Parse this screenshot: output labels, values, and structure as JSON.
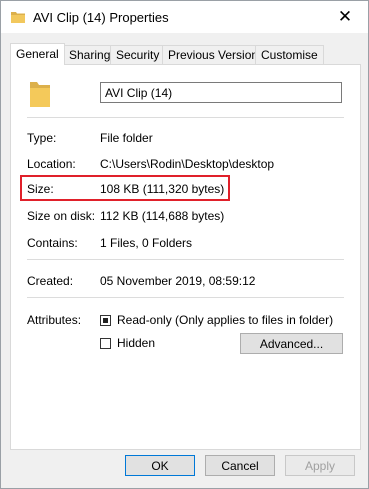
{
  "window": {
    "title": "AVI Clip (14) Properties",
    "close_symbol": "✕"
  },
  "tabs": [
    {
      "label": "General"
    },
    {
      "label": "Sharing"
    },
    {
      "label": "Security"
    },
    {
      "label": "Previous Versions"
    },
    {
      "label": "Customise"
    }
  ],
  "general": {
    "name": "AVI Clip (14)",
    "type_label": "Type:",
    "type_value": "File folder",
    "location_label": "Location:",
    "location_value": "C:\\Users\\Rodin\\Desktop\\desktop",
    "size_label": "Size:",
    "size_value": "108 KB (111,320 bytes)",
    "size_on_disk_label": "Size on disk:",
    "size_on_disk_value": "112 KB (114,688 bytes)",
    "contains_label": "Contains:",
    "contains_value": "1 Files, 0 Folders",
    "created_label": "Created:",
    "created_value": "05 November 2019, 08:59:12",
    "attributes_label": "Attributes:",
    "readonly_label": "Read-only (Only applies to files in folder)",
    "hidden_label": "Hidden",
    "advanced_label": "Advanced..."
  },
  "footer": {
    "ok_label": "OK",
    "cancel_label": "Cancel",
    "apply_label": "Apply"
  },
  "colors": {
    "highlight": "#e0202a",
    "folder": "#e8b84a"
  }
}
